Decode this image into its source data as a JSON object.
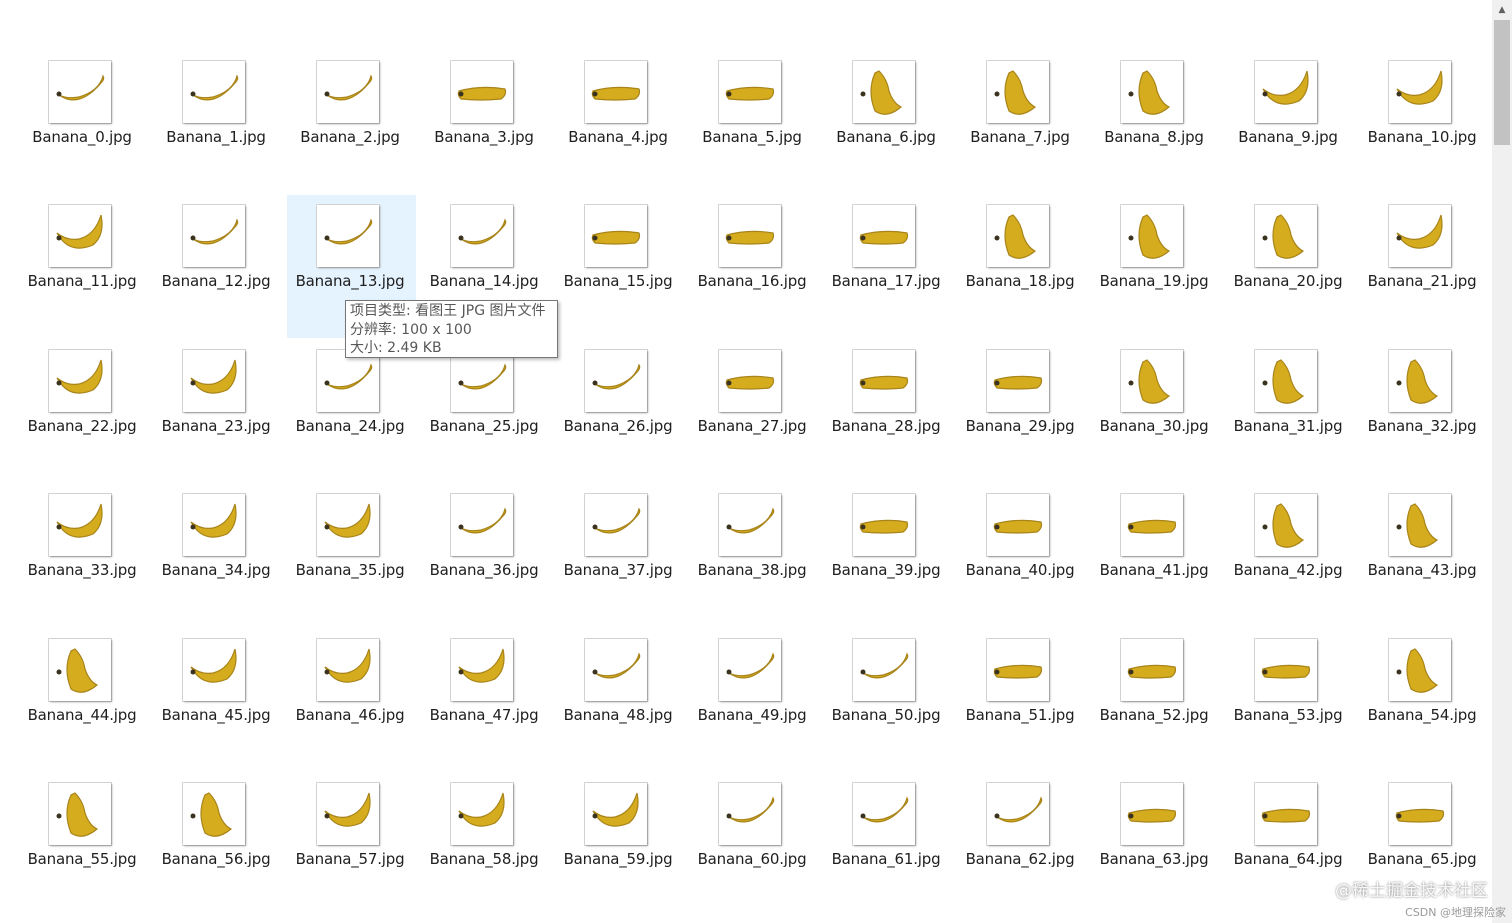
{
  "files": [
    "Banana_0.jpg",
    "Banana_1.jpg",
    "Banana_2.jpg",
    "Banana_3.jpg",
    "Banana_4.jpg",
    "Banana_5.jpg",
    "Banana_6.jpg",
    "Banana_7.jpg",
    "Banana_8.jpg",
    "Banana_9.jpg",
    "Banana_10.jpg",
    "Banana_11.jpg",
    "Banana_12.jpg",
    "Banana_13.jpg",
    "Banana_14.jpg",
    "Banana_15.jpg",
    "Banana_16.jpg",
    "Banana_17.jpg",
    "Banana_18.jpg",
    "Banana_19.jpg",
    "Banana_20.jpg",
    "Banana_21.jpg",
    "Banana_22.jpg",
    "Banana_23.jpg",
    "Banana_24.jpg",
    "Banana_25.jpg",
    "Banana_26.jpg",
    "Banana_27.jpg",
    "Banana_28.jpg",
    "Banana_29.jpg",
    "Banana_30.jpg",
    "Banana_31.jpg",
    "Banana_32.jpg",
    "Banana_33.jpg",
    "Banana_34.jpg",
    "Banana_35.jpg",
    "Banana_36.jpg",
    "Banana_37.jpg",
    "Banana_38.jpg",
    "Banana_39.jpg",
    "Banana_40.jpg",
    "Banana_41.jpg",
    "Banana_42.jpg",
    "Banana_43.jpg",
    "Banana_44.jpg",
    "Banana_45.jpg",
    "Banana_46.jpg",
    "Banana_47.jpg",
    "Banana_48.jpg",
    "Banana_49.jpg",
    "Banana_50.jpg",
    "Banana_51.jpg",
    "Banana_52.jpg",
    "Banana_53.jpg",
    "Banana_54.jpg",
    "Banana_55.jpg",
    "Banana_56.jpg",
    "Banana_57.jpg",
    "Banana_58.jpg",
    "Banana_59.jpg",
    "Banana_60.jpg",
    "Banana_61.jpg",
    "Banana_62.jpg",
    "Banana_63.jpg",
    "Banana_64.jpg",
    "Banana_65.jpg"
  ],
  "selected_index": 13,
  "thumbnail_icon": "banana-thumbnail-icon",
  "colors": {
    "banana": "#d4ac1e",
    "banana_shade": "#a8841a",
    "banana_tip": "#3b3320",
    "selection": "#e5f3ff"
  },
  "tooltip": {
    "type": "项目类型: 看图王 JPG 图片文件",
    "resolution": "分辨率: 100 x 100",
    "size": "大小: 2.49 KB"
  },
  "watermark": "@稀土掘金技术社区",
  "watermark_small": "CSDN @地理探险家",
  "scrollbar": {
    "up_icon": "scroll-up-arrow-icon"
  }
}
